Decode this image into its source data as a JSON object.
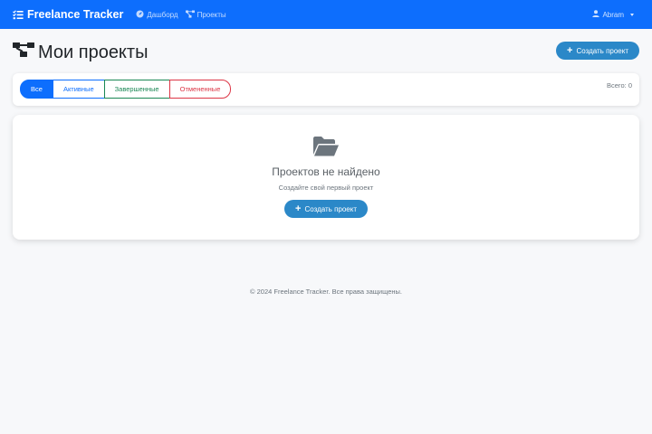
{
  "navbar": {
    "brand": "Freelance Tracker",
    "links": [
      {
        "label": "Дашборд",
        "icon": "dashboard-icon"
      },
      {
        "label": "Проекты",
        "icon": "project-diagram-icon"
      }
    ],
    "user": "Abram"
  },
  "header": {
    "title": "Мои проекты",
    "create_label": "Создать проект"
  },
  "filters": {
    "items": [
      {
        "label": "Все",
        "active": true
      },
      {
        "label": "Активные",
        "active": false
      },
      {
        "label": "Завершенные",
        "active": false
      },
      {
        "label": "Отмененные",
        "active": false
      }
    ],
    "total": "Всего: 0"
  },
  "empty": {
    "title": "Проектов не найдено",
    "subtitle": "Создайте свой первый проект",
    "create_label": "Создать проект"
  },
  "footer": {
    "text": "© 2024 Freelance Tracker. Все права защищены."
  },
  "colors": {
    "primary": "#0d6efd",
    "button": "#2b88c8",
    "success": "#198754",
    "danger": "#dc3545",
    "muted": "#6c757d"
  }
}
